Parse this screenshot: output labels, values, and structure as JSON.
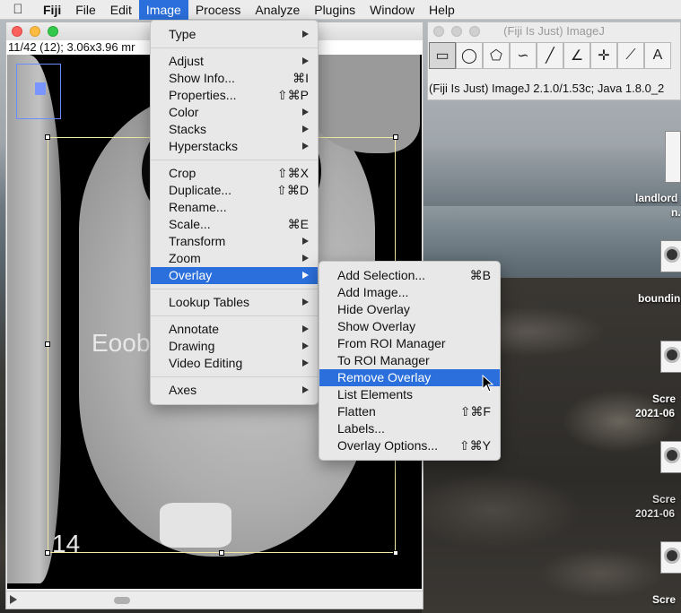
{
  "menubar": {
    "apple": "",
    "app": "Fiji",
    "items": [
      "File",
      "Edit",
      "Image",
      "Process",
      "Analyze",
      "Plugins",
      "Window",
      "Help"
    ],
    "active": "Image"
  },
  "image_window": {
    "info": "11/42 (12); 3.06x3.96 mr",
    "overlay_text": "Eoob",
    "overlay_number": "14"
  },
  "imagej_window": {
    "title": "(Fiji Is Just) ImageJ",
    "status": "(Fiji Is Just) ImageJ 2.1.0/1.53c; Java 1.8.0_2",
    "tools": [
      "rectangle-tool",
      "oval-tool",
      "polygon-tool",
      "freehand-tool",
      "line-tool",
      "angle-tool",
      "point-tool",
      "wand-tool",
      "text-tool"
    ]
  },
  "desktop": {
    "icon_labels": [
      "landlord",
      "n.",
      "bounding",
      "Scre",
      "2021-06",
      "Scre",
      "2021-06",
      "Scre"
    ]
  },
  "image_menu": {
    "items": [
      {
        "label": "Type",
        "submenu": true
      },
      {
        "sep": true
      },
      {
        "label": "Adjust",
        "submenu": true
      },
      {
        "label": "Show Info...",
        "shortcut": "⌘I"
      },
      {
        "label": "Properties...",
        "shortcut": "⇧⌘P"
      },
      {
        "label": "Color",
        "submenu": true
      },
      {
        "label": "Stacks",
        "submenu": true
      },
      {
        "label": "Hyperstacks",
        "submenu": true
      },
      {
        "sep": true
      },
      {
        "label": "Crop",
        "shortcut": "⇧⌘X"
      },
      {
        "label": "Duplicate...",
        "shortcut": "⇧⌘D"
      },
      {
        "label": "Rename..."
      },
      {
        "label": "Scale...",
        "shortcut": "⌘E"
      },
      {
        "label": "Transform",
        "submenu": true
      },
      {
        "label": "Zoom",
        "submenu": true
      },
      {
        "label": "Overlay",
        "submenu": true,
        "highlighted": true
      },
      {
        "sep": true
      },
      {
        "label": "Lookup Tables",
        "submenu": true
      },
      {
        "sep": true
      },
      {
        "label": "Annotate",
        "submenu": true
      },
      {
        "label": "Drawing",
        "submenu": true
      },
      {
        "label": "Video Editing",
        "submenu": true
      },
      {
        "sep": true
      },
      {
        "label": "Axes",
        "submenu": true
      }
    ]
  },
  "overlay_menu": {
    "items": [
      {
        "label": "Add Selection...",
        "shortcut": "⌘B"
      },
      {
        "label": "Add Image..."
      },
      {
        "label": "Hide Overlay"
      },
      {
        "label": "Show Overlay"
      },
      {
        "label": "From ROI Manager"
      },
      {
        "label": "To ROI Manager"
      },
      {
        "label": "Remove Overlay",
        "highlighted": true
      },
      {
        "label": "List Elements"
      },
      {
        "label": "Flatten",
        "shortcut": "⇧⌘F"
      },
      {
        "label": "Labels..."
      },
      {
        "label": "Overlay Options...",
        "shortcut": "⇧⌘Y"
      }
    ]
  },
  "colors": {
    "highlight": "#2a6fdb",
    "roi": "#f2e9a8"
  }
}
